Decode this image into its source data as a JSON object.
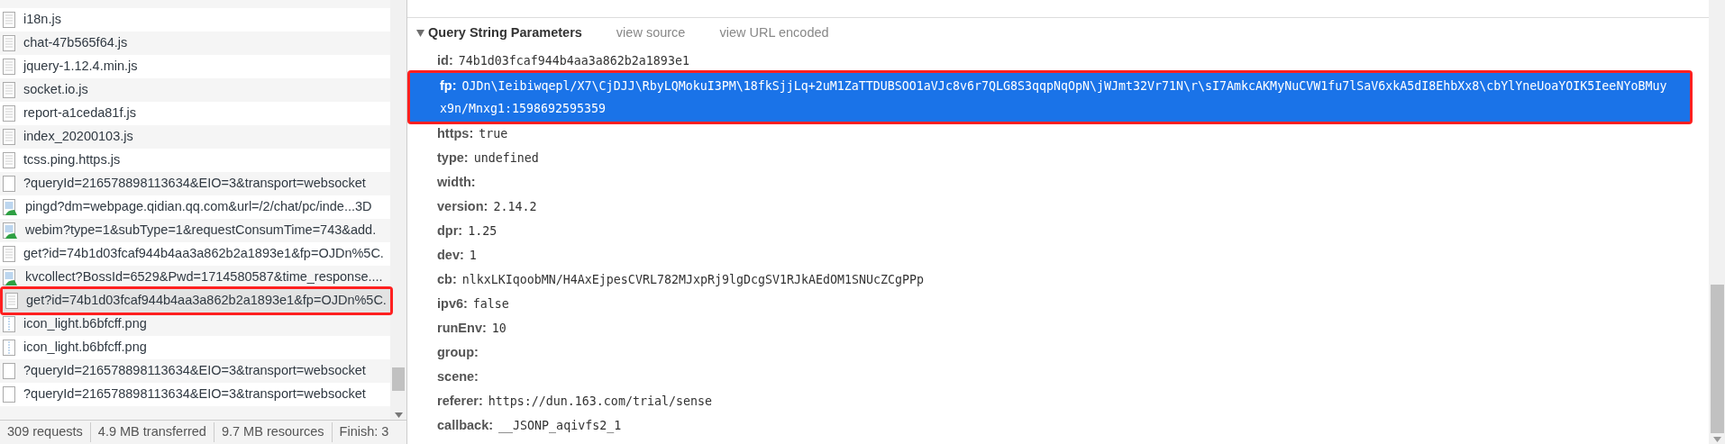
{
  "requests": [
    {
      "name": "i18n.js",
      "kind": "script",
      "selected": false
    },
    {
      "name": "chat-47b565f64.js",
      "kind": "script",
      "selected": false
    },
    {
      "name": "jquery-1.12.4.min.js",
      "kind": "script",
      "selected": false
    },
    {
      "name": "socket.io.js",
      "kind": "script",
      "selected": false
    },
    {
      "name": "report-a1ceda81f.js",
      "kind": "script",
      "selected": false
    },
    {
      "name": "index_20200103.js",
      "kind": "script",
      "selected": false
    },
    {
      "name": "tcss.ping.https.js",
      "kind": "script",
      "selected": false
    },
    {
      "name": "?queryId=216578898113634&EIO=3&transport=websocket",
      "kind": "blank",
      "selected": false
    },
    {
      "name": "pingd?dm=webpage.qidian.qq.com&url=/2/chat/pc/inde...3D",
      "kind": "image",
      "selected": false
    },
    {
      "name": "webim?type=1&subType=1&requestConsumTime=743&add.",
      "kind": "image",
      "selected": false
    },
    {
      "name": "get?id=74b1d03fcaf944b4aa3a862b2a1893e1&fp=OJDn%5C.",
      "kind": "script",
      "selected": false
    },
    {
      "name": "kvcollect?BossId=6529&Pwd=1714580587&time_response....",
      "kind": "image",
      "selected": false
    },
    {
      "name": "get?id=74b1d03fcaf944b4aa3a862b2a1893e1&fp=OJDn%5C.",
      "kind": "script",
      "selected": true
    },
    {
      "name": "icon_light.b6bfcff.png",
      "kind": "png",
      "selected": false
    },
    {
      "name": "icon_light.b6bfcff.png",
      "kind": "png",
      "selected": false
    },
    {
      "name": "?queryId=216578898113634&EIO=3&transport=websocket",
      "kind": "blank",
      "selected": false
    },
    {
      "name": "?queryId=216578898113634&EIO=3&transport=websocket",
      "kind": "blank",
      "selected": false
    }
  ],
  "status_bar": [
    "309 requests",
    "4.9 MB transferred",
    "9.7 MB resources",
    "Finish: 3"
  ],
  "query_section": {
    "title": "Query String Parameters",
    "expanded": true,
    "links": [
      "view source",
      "view URL encoded"
    ],
    "params": [
      {
        "key": "id:",
        "value": "74b1d03fcaf944b4aa3a862b2a1893e1",
        "selected": false
      },
      {
        "key": "fp:",
        "value": "OJDn\\Ieibiwqepl/X7\\CjDJJ\\RbyLQMokuI3PM\\18fkSjjLq+2uM1ZaTTDUBSOO1aVJc8v6r7QLG8S3qqpNqOpN\\jWJmt32Vr71N\\r\\sI7AmkcAKMyNuCVW1fu7lSaV6xkA5dI8EhbXx8\\cbYlYneUoaYOIK5IeeNYoBMuyx9n/Mnxg1:1598692595359",
        "selected": true
      },
      {
        "key": "https:",
        "value": "true",
        "selected": false
      },
      {
        "key": "type:",
        "value": "undefined",
        "selected": false
      },
      {
        "key": "width:",
        "selected": false
      },
      {
        "key": "version:",
        "value": "2.14.2",
        "selected": false
      },
      {
        "key": "dpr:",
        "value": "1.25",
        "selected": false
      },
      {
        "key": "dev:",
        "value": "1",
        "selected": false
      },
      {
        "key": "cb:",
        "value": "nlkxLKIqoobMN/H4AxEjpesCVRL782MJxpRj9lgDcgSV1RJkAEdOM1SNUcZCgPPp",
        "selected": false
      },
      {
        "key": "ipv6:",
        "value": "false",
        "selected": false
      },
      {
        "key": "runEnv:",
        "value": "10",
        "selected": false
      },
      {
        "key": "group:",
        "selected": false
      },
      {
        "key": "scene:",
        "selected": false
      },
      {
        "key": "referer:",
        "value": "https://dun.163.com/trial/sense",
        "selected": false
      },
      {
        "key": "callback:",
        "value": "__JSONP_aqivfs2_1",
        "selected": false
      }
    ]
  }
}
